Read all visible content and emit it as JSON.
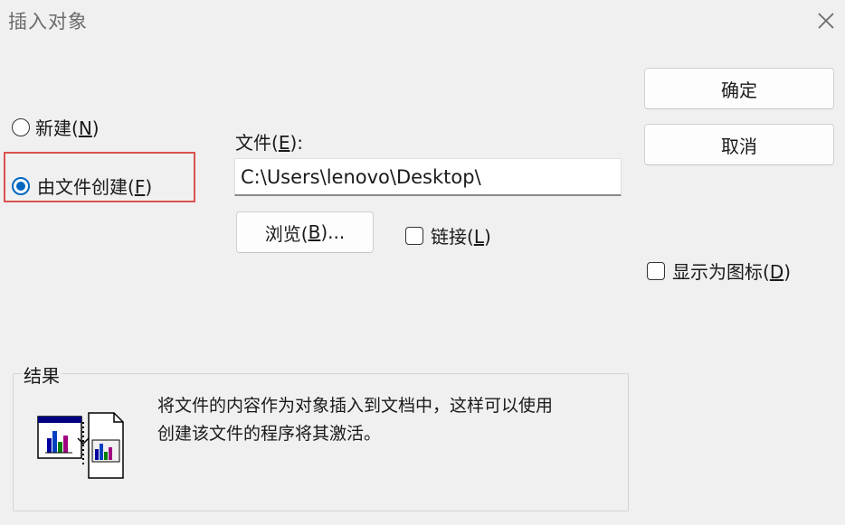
{
  "dialog": {
    "title": "插入对象",
    "close_icon": "close-icon"
  },
  "mode": {
    "create_new_pre": "新建(",
    "create_new_key": "N",
    "create_new_post": ")",
    "from_file_pre": "由文件创建(",
    "from_file_key": "F",
    "from_file_post": ")",
    "selected": "from_file"
  },
  "file": {
    "label_pre": "文件(",
    "label_key": "E",
    "label_post": "):",
    "value": "C:\\Users\\lenovo\\Desktop\\"
  },
  "browse": {
    "pre": "浏览(",
    "key": "B",
    "post": ")..."
  },
  "link": {
    "pre": "链接(",
    "key": "L",
    "post": ")",
    "checked": false
  },
  "buttons": {
    "ok": "确定",
    "cancel": "取消"
  },
  "display_as_icon": {
    "pre": "显示为图标(",
    "key": "D",
    "post": ")",
    "checked": false
  },
  "result": {
    "label": "结果",
    "line1": "将文件的内容作为对象插入到文档中，这样可以使用",
    "line2": "创建该文件的程序将其激活。",
    "icon": "insert-file-object-icon"
  },
  "colors": {
    "accent": "#0067c0",
    "highlight": "#d9534f",
    "background": "#f0f0f0"
  }
}
